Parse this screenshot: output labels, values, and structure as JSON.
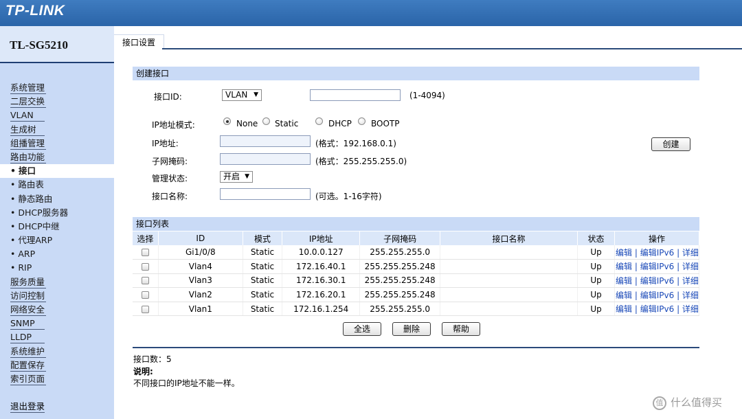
{
  "header": {
    "logo": "TP-LINK",
    "model": "TL-SG5210"
  },
  "sidebar": {
    "items": [
      {
        "label": "系统管理",
        "sub": false
      },
      {
        "label": "二层交换",
        "sub": false
      },
      {
        "label": "VLAN",
        "sub": false
      },
      {
        "label": "生成树",
        "sub": false
      },
      {
        "label": "组播管理",
        "sub": false
      },
      {
        "label": "路由功能",
        "sub": false
      },
      {
        "label": "接口",
        "sub": true,
        "active": true
      },
      {
        "label": "路由表",
        "sub": true
      },
      {
        "label": "静态路由",
        "sub": true
      },
      {
        "label": "DHCP服务器",
        "sub": true
      },
      {
        "label": "DHCP中继",
        "sub": true
      },
      {
        "label": "代理ARP",
        "sub": true
      },
      {
        "label": "ARP",
        "sub": true
      },
      {
        "label": "RIP",
        "sub": true
      },
      {
        "label": "服务质量",
        "sub": false
      },
      {
        "label": "访问控制",
        "sub": false
      },
      {
        "label": "网络安全",
        "sub": false
      },
      {
        "label": "SNMP",
        "sub": false
      },
      {
        "label": "LLDP",
        "sub": false
      },
      {
        "label": "系统维护",
        "sub": false
      },
      {
        "label": "配置保存",
        "sub": false
      },
      {
        "label": "索引页面",
        "sub": false
      }
    ],
    "sub_bullet": "•",
    "logout": "退出登录"
  },
  "tab": {
    "label": "接口设置"
  },
  "create": {
    "title": "创建接口",
    "iface_id_label": "接口ID:",
    "iface_type": "VLAN",
    "iface_id_value": "",
    "iface_id_range": "(1-4094)",
    "ip_mode_label": "IP地址模式:",
    "modes": [
      "None",
      "Static",
      "DHCP",
      "BOOTP"
    ],
    "mode_selected": "None",
    "ip_label": "IP地址:",
    "ip_hint": "(格式：192.168.0.1)",
    "mask_label": "子网掩码:",
    "mask_hint": "(格式：255.255.255.0)",
    "admin_label": "管理状态:",
    "admin_value": "开启",
    "name_label": "接口名称:",
    "name_hint": "(可选。1-16字符)",
    "create_button": "创建"
  },
  "list": {
    "title": "接口列表",
    "columns": [
      "选择",
      "ID",
      "模式",
      "IP地址",
      "子网掩码",
      "接口名称",
      "状态",
      "操作"
    ],
    "rows": [
      {
        "id": "Gi1/0/8",
        "mode": "Static",
        "ip": "10.0.0.127",
        "mask": "255.255.255.0",
        "name": "",
        "status": "Up"
      },
      {
        "id": "Vlan4",
        "mode": "Static",
        "ip": "172.16.40.1",
        "mask": "255.255.255.248",
        "name": "",
        "status": "Up"
      },
      {
        "id": "Vlan3",
        "mode": "Static",
        "ip": "172.16.30.1",
        "mask": "255.255.255.248",
        "name": "",
        "status": "Up"
      },
      {
        "id": "Vlan2",
        "mode": "Static",
        "ip": "172.16.20.1",
        "mask": "255.255.255.248",
        "name": "",
        "status": "Up"
      },
      {
        "id": "Vlan1",
        "mode": "Static",
        "ip": "172.16.1.254",
        "mask": "255.255.255.0",
        "name": "",
        "status": "Up"
      }
    ],
    "ops": [
      "编辑",
      "编辑IPv6",
      "详细"
    ],
    "ops_separator": " | ",
    "select_all_button": "全选",
    "delete_button": "删除",
    "help_button": "帮助"
  },
  "footer": {
    "count_label": "接口数：",
    "count": "5",
    "note_title": "说明:",
    "note_text": "不同接口的IP地址不能一样。"
  },
  "watermark": {
    "icon": "值",
    "text": "什么值得买"
  }
}
